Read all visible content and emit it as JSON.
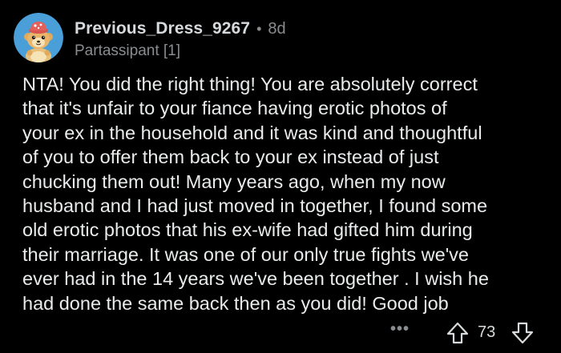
{
  "comment": {
    "avatar_icon": "snoo-avatar-icon",
    "username": "Previous_Dress_9267",
    "separator": "•",
    "age": "8d",
    "flair": "Partassipant [1]",
    "body": "NTA! You did the right thing! You are absolutely correct\nthat it's unfair to your fiance having erotic photos of\nyour ex in the household and it was kind and thoughtful\nof you to offer them back to your ex instead of just\nchucking them out! Many years ago, when my now\nhusband and I had just moved in together, I found some\nold erotic photos that his ex-wife had gifted him during\ntheir marriage. It was one of our only true fights we've\never had in the 14 years we've been together . I wish he\nhad done the same back then as you did! Good job",
    "actions": {
      "more_label": "•••",
      "more_icon": "more-options-icon",
      "upvote_icon": "upvote-arrow-icon",
      "score": "73",
      "downvote_icon": "downvote-arrow-icon"
    }
  },
  "colors": {
    "background": "#000000",
    "text_primary": "#d7dadc",
    "text_secondary": "#8a8d90",
    "avatar_bg": "#4a9fd8"
  }
}
